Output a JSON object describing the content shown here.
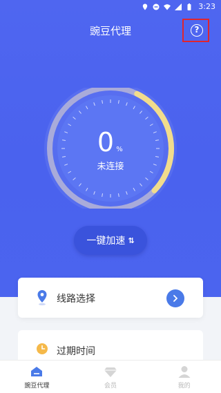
{
  "status": {
    "time": "3:23"
  },
  "header": {
    "title": "豌豆代理",
    "help_icon": "question-circle-icon"
  },
  "gauge": {
    "value": "0",
    "unit": "%",
    "status": "未连接",
    "progress_fraction": 0.3
  },
  "accelerate_button": {
    "label": "一键加速",
    "icon": "swap-arrows-icon"
  },
  "route_card": {
    "label": "线路选择",
    "icon": "location-pin-icon",
    "action_icon": "chevron-right-icon"
  },
  "expire_card": {
    "label": "过期时间",
    "icon": "clock-icon"
  },
  "tabbar": {
    "tabs": [
      {
        "label": "豌豆代理",
        "icon": "home-icon",
        "active": true
      },
      {
        "label": "会员",
        "icon": "diamond-icon",
        "active": false
      },
      {
        "label": "我的",
        "icon": "user-icon",
        "active": false
      }
    ]
  },
  "colors": {
    "primary": "#4b64ef",
    "button": "#3a53dc",
    "arc": "#f1dc8c",
    "highlight_box": "#e0252e"
  }
}
